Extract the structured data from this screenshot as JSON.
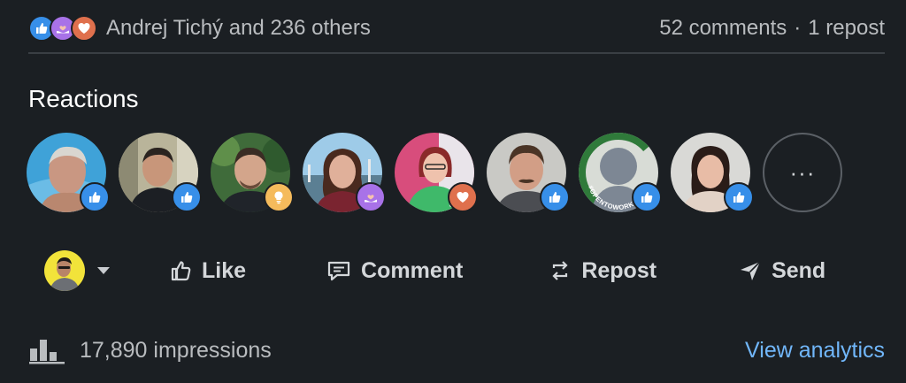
{
  "summary": {
    "reactors_text": "Andrej Tichý and 236 others",
    "comments_text": "52 comments",
    "separator": "·",
    "reposts_text": "1 repost",
    "reaction_icons": [
      "like-icon",
      "support-icon",
      "love-icon"
    ]
  },
  "reactions": {
    "title": "Reactions",
    "people": [
      {
        "reaction": "like",
        "badge_icon": "like-icon"
      },
      {
        "reaction": "like",
        "badge_icon": "like-icon"
      },
      {
        "reaction": "insightful",
        "badge_icon": "insightful-icon"
      },
      {
        "reaction": "support",
        "badge_icon": "support-icon"
      },
      {
        "reaction": "love",
        "badge_icon": "love-icon"
      },
      {
        "reaction": "like",
        "badge_icon": "like-icon"
      },
      {
        "reaction": "like",
        "badge_icon": "like-icon"
      },
      {
        "reaction": "like",
        "badge_icon": "like-icon"
      }
    ],
    "more_label": "···",
    "avatar_ring_text": "#OPENTOWORK"
  },
  "actions": {
    "like_label": "Like",
    "comment_label": "Comment",
    "repost_label": "Repost",
    "send_label": "Send"
  },
  "footer": {
    "impressions_text": "17,890 impressions",
    "analytics_label": "View analytics"
  },
  "colors": {
    "background": "#1b1f23",
    "like": "#378fe9",
    "love": "#df704d",
    "insightful": "#f5bb5c",
    "support": "#a872e8",
    "link": "#71b7fb",
    "open_to_work": "#2f7a3a"
  }
}
